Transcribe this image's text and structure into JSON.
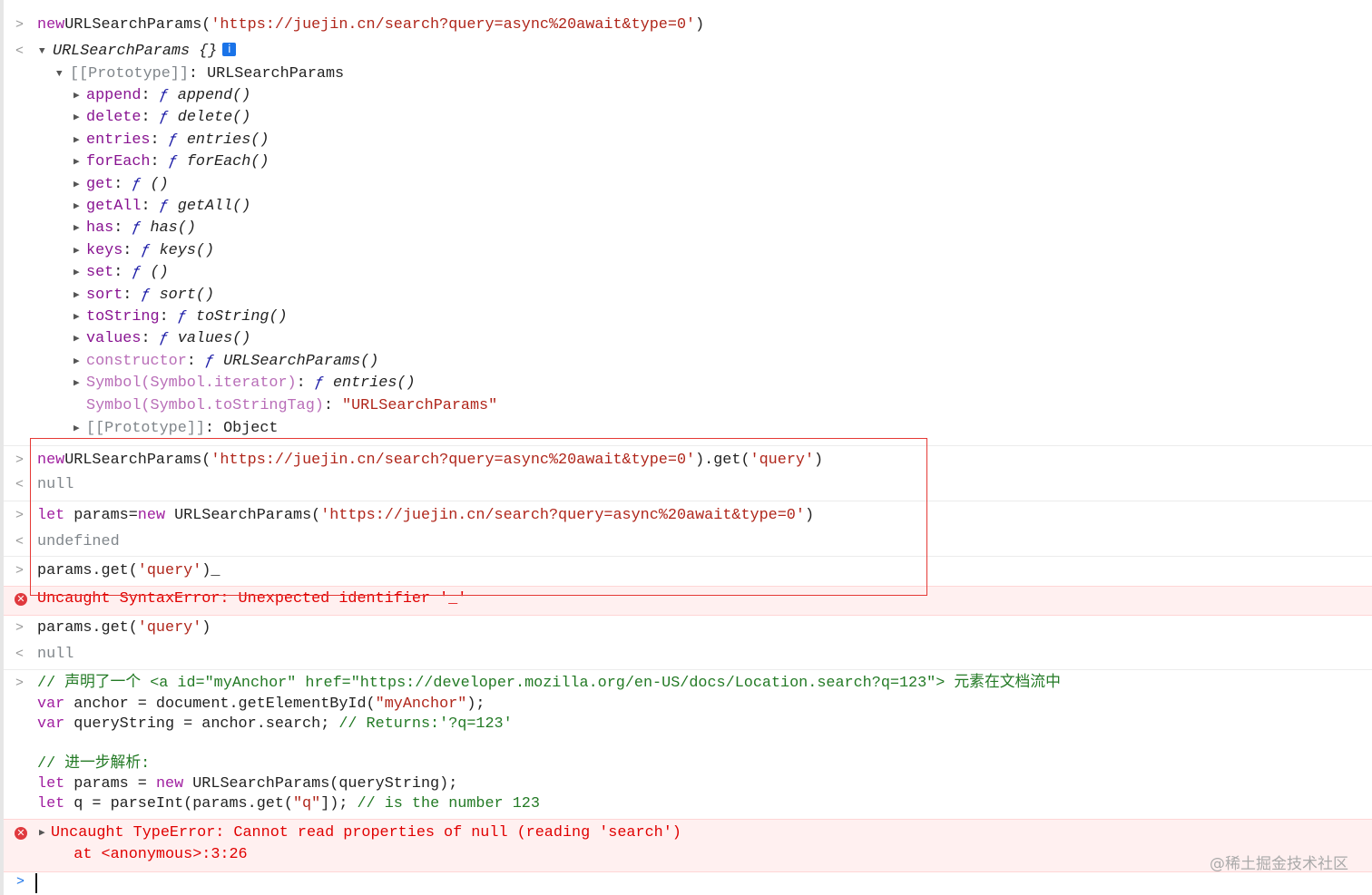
{
  "console": {
    "lines": [
      {
        "p": ">",
        "t": [
          [
            "kw",
            "new"
          ],
          [
            "",
            "URLSearchParams("
          ],
          [
            "str",
            "'https://juejin.cn/search?query=async%20await&type=0'"
          ],
          [
            "",
            ")"
          ]
        ]
      },
      {
        "p": "<",
        "tri": "▼",
        "t": [
          [
            "it",
            "URLSearchParams {}"
          ]
        ],
        "info": "i"
      },
      {
        "tri": "▼",
        "t": [
          [
            "gray",
            "[[Prototype]]"
          ],
          [
            "",
            ": URLSearchParams"
          ]
        ]
      },
      {
        "tri": "▶",
        "t": [
          [
            "prop",
            "append"
          ],
          [
            "",
            ": "
          ],
          [
            "fsym",
            "ƒ "
          ],
          [
            "fn",
            "append()"
          ]
        ]
      },
      {
        "tri": "▶",
        "t": [
          [
            "prop",
            "delete"
          ],
          [
            "",
            ": "
          ],
          [
            "fsym",
            "ƒ "
          ],
          [
            "fn",
            "delete()"
          ]
        ]
      },
      {
        "tri": "▶",
        "t": [
          [
            "prop",
            "entries"
          ],
          [
            "",
            ": "
          ],
          [
            "fsym",
            "ƒ "
          ],
          [
            "fn",
            "entries()"
          ]
        ]
      },
      {
        "tri": "▶",
        "t": [
          [
            "prop",
            "forEach"
          ],
          [
            "",
            ": "
          ],
          [
            "fsym",
            "ƒ "
          ],
          [
            "fn",
            "forEach()"
          ]
        ]
      },
      {
        "tri": "▶",
        "t": [
          [
            "prop",
            "get"
          ],
          [
            "",
            ": "
          ],
          [
            "fsym",
            "ƒ "
          ],
          [
            "fn",
            "()"
          ]
        ]
      },
      {
        "tri": "▶",
        "t": [
          [
            "prop",
            "getAll"
          ],
          [
            "",
            ": "
          ],
          [
            "fsym",
            "ƒ "
          ],
          [
            "fn",
            "getAll()"
          ]
        ]
      },
      {
        "tri": "▶",
        "t": [
          [
            "prop",
            "has"
          ],
          [
            "",
            ": "
          ],
          [
            "fsym",
            "ƒ "
          ],
          [
            "fn",
            "has()"
          ]
        ]
      },
      {
        "tri": "▶",
        "t": [
          [
            "prop",
            "keys"
          ],
          [
            "",
            ": "
          ],
          [
            "fsym",
            "ƒ "
          ],
          [
            "fn",
            "keys()"
          ]
        ]
      },
      {
        "tri": "▶",
        "t": [
          [
            "prop",
            "set"
          ],
          [
            "",
            ": "
          ],
          [
            "fsym",
            "ƒ "
          ],
          [
            "fn",
            "()"
          ]
        ]
      },
      {
        "tri": "▶",
        "t": [
          [
            "prop",
            "sort"
          ],
          [
            "",
            ": "
          ],
          [
            "fsym",
            "ƒ "
          ],
          [
            "fn",
            "sort()"
          ]
        ]
      },
      {
        "tri": "▶",
        "t": [
          [
            "prop",
            "toString"
          ],
          [
            "",
            ": "
          ],
          [
            "fsym",
            "ƒ "
          ],
          [
            "fn",
            "toString()"
          ]
        ]
      },
      {
        "tri": "▶",
        "t": [
          [
            "prop",
            "values"
          ],
          [
            "",
            ": "
          ],
          [
            "fsym",
            "ƒ "
          ],
          [
            "fn",
            "values()"
          ]
        ]
      },
      {
        "tri": "▶",
        "t": [
          [
            "dim",
            "constructor"
          ],
          [
            "",
            ": "
          ],
          [
            "fsym",
            "ƒ "
          ],
          [
            "fn",
            "URLSearchParams()"
          ]
        ]
      },
      {
        "tri": "▶",
        "t": [
          [
            "dim",
            "Symbol(Symbol.iterator)"
          ],
          [
            "",
            ": "
          ],
          [
            "fsym",
            "ƒ "
          ],
          [
            "fn",
            "entries()"
          ]
        ]
      },
      {
        "t": [
          [
            "dim",
            "Symbol(Symbol.toStringTag)"
          ],
          [
            "",
            ": "
          ],
          [
            "str",
            "\"URLSearchParams\""
          ]
        ]
      },
      {
        "tri": "▶",
        "t": [
          [
            "gray",
            "[[Prototype]]"
          ],
          [
            "",
            ": Object"
          ]
        ]
      },
      {
        "p": ">",
        "t": [
          [
            "kw",
            "new"
          ],
          [
            "",
            "URLSearchParams("
          ],
          [
            "str",
            "'https://juejin.cn/search?query=async%20await&type=0'"
          ],
          [
            "",
            ").get("
          ],
          [
            "str",
            "'query'"
          ],
          [
            "",
            ")"
          ]
        ]
      },
      {
        "p": "<",
        "t": [
          [
            "gray",
            "null"
          ]
        ]
      },
      {
        "p": ">",
        "t": [
          [
            "kw",
            "let"
          ],
          [
            "",
            " params="
          ],
          [
            "kw",
            "new"
          ],
          [
            "",
            " URLSearchParams("
          ],
          [
            "str",
            "'https://juejin.cn/search?query=async%20await&type=0'"
          ],
          [
            "",
            ")"
          ]
        ]
      },
      {
        "p": "<",
        "t": [
          [
            "gray",
            "undefined"
          ]
        ]
      },
      {
        "p": ">",
        "t": [
          [
            "",
            "params.get("
          ],
          [
            "str",
            "'query'"
          ],
          [
            "",
            ")_"
          ]
        ]
      },
      {
        "e": "x",
        "t": [
          [
            "err",
            "Uncaught SyntaxError: Unexpected identifier '_'"
          ]
        ]
      },
      {
        "p": ">",
        "t": [
          [
            "",
            "params.get("
          ],
          [
            "str",
            "'query'"
          ],
          [
            "",
            ")"
          ]
        ]
      },
      {
        "p": "<",
        "t": [
          [
            "gray",
            "null"
          ]
        ]
      },
      {
        "p": ">",
        "t": [
          [
            "cm",
            "// 声明了一个 <a id=\"myAnchor\" href=\"https://developer.mozilla.org/en-US/docs/Location.search?q=123\"> 元素在文档流中"
          ]
        ]
      },
      {
        "t": [
          [
            "kw",
            "var"
          ],
          [
            "",
            " anchor = document.getElementById("
          ],
          [
            "str",
            "\"myAnchor\""
          ],
          [
            "",
            ");"
          ]
        ]
      },
      {
        "t": [
          [
            "kw",
            "var"
          ],
          [
            "",
            " queryString = anchor.search; "
          ],
          [
            "cm",
            "// Returns:'?q=123'"
          ]
        ]
      },
      {
        "t": [
          [
            "cm",
            "// 进一步解析:"
          ]
        ]
      },
      {
        "t": [
          [
            "kw",
            "let"
          ],
          [
            "",
            " params = "
          ],
          [
            "kw",
            "new"
          ],
          [
            "",
            " URLSearchParams(queryString);"
          ]
        ]
      },
      {
        "t": [
          [
            "kw",
            "let"
          ],
          [
            "",
            " q = parseInt(params.get("
          ],
          [
            "str",
            "\"q\""
          ],
          [
            "",
            "]); "
          ],
          [
            "cm",
            "// is the number 123"
          ]
        ]
      },
      {
        "e": "x",
        "tri": "▶",
        "t": [
          [
            "err",
            "Uncaught TypeError: Cannot read properties of null (reading 'search')"
          ]
        ]
      },
      {
        "t": [
          [
            "err",
            "    at <anonymous>:3:26"
          ]
        ]
      }
    ],
    "prompt": ">",
    "watermark": "@稀土掘金技术社区"
  },
  "colors": {
    "error_bg": "#fff0f0",
    "error_text": "#e00000",
    "highlight_box": "#e53935",
    "comment": "#237a25",
    "string": "#b0261b"
  }
}
